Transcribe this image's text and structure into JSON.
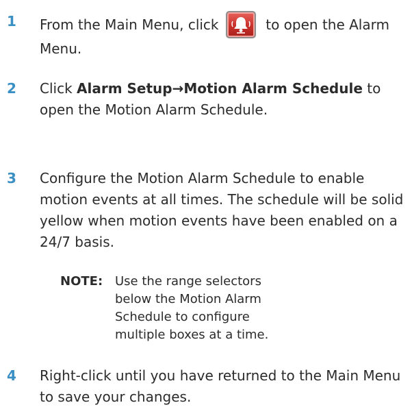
{
  "steps": [
    {
      "number": "1",
      "text_before_icon": "From the Main Menu, click",
      "icon": "alarm-bell-icon",
      "text_after_icon": "to open the Alarm Menu."
    },
    {
      "number": "2",
      "text_prefix": "Click ",
      "bold_path": "Alarm Setup→Motion Alarm Schedule",
      "text_suffix": " to open the Motion Alarm Schedule."
    },
    {
      "number": "3",
      "text": "Configure the Motion Alarm Schedule to enable motion events at all times. The schedule will be solid yellow when motion events have been enabled on a 24/7 basis."
    },
    {
      "number": "4",
      "text": "Right-click until you have returned to the Main Menu to save your changes."
    }
  ],
  "note": {
    "label": "NOTE:",
    "text": "Use the range selectors below the Motion Alarm Schedule to configure multiple boxes at a time."
  },
  "colors": {
    "step_number": "#3a8fc4",
    "body_text": "#2b2b2b",
    "alarm_icon_red": "#c9302a"
  }
}
